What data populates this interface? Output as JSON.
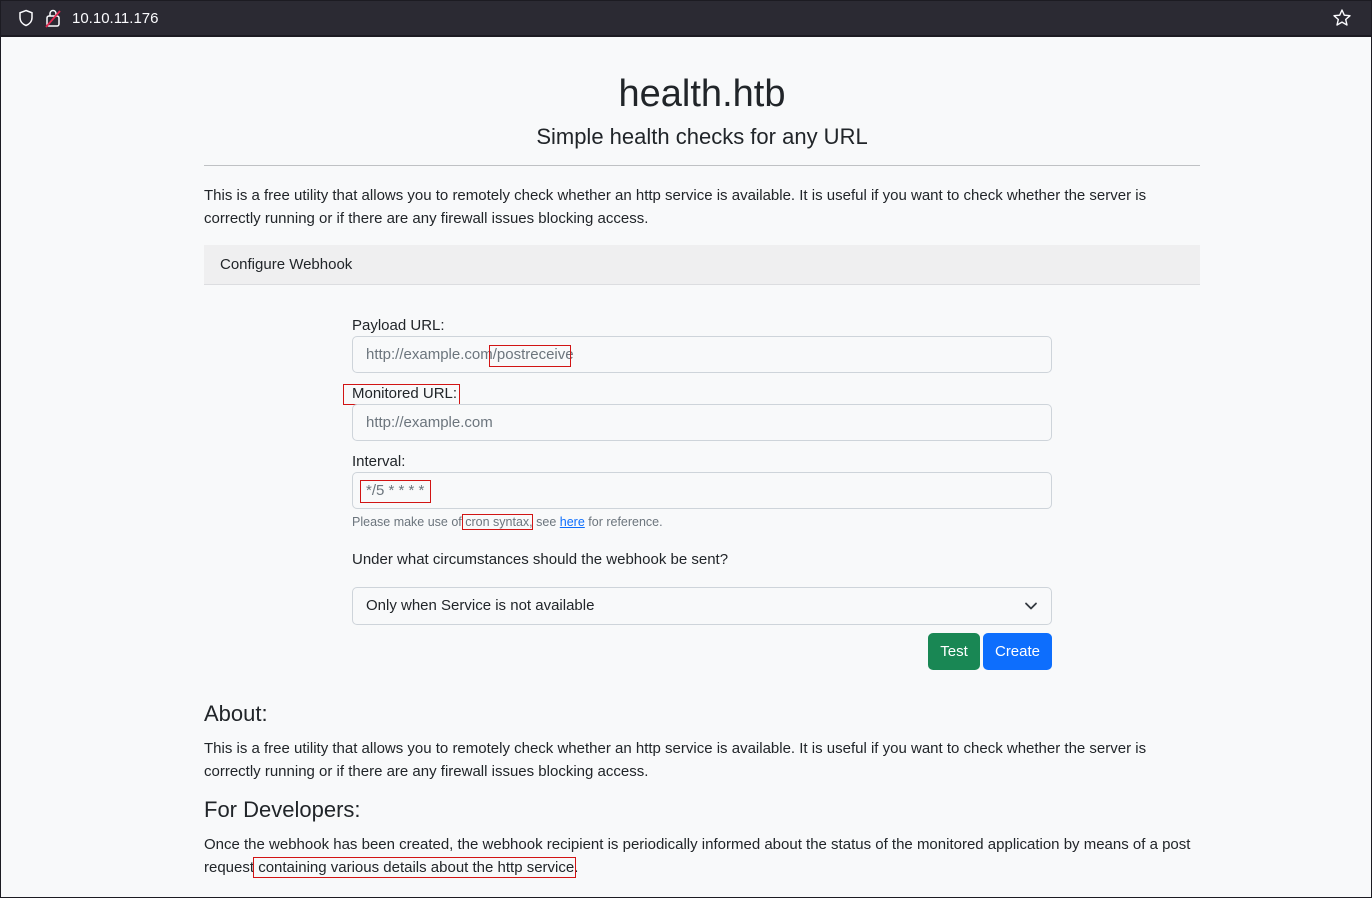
{
  "browser": {
    "url": "10.10.11.176"
  },
  "page": {
    "title": "health.htb",
    "subtitle": "Simple health checks for any URL",
    "intro": "This is a free utility that allows you to remotely check whether an http service is available. It is useful if you want to check whether the server is correctly running or if there are any firewall issues blocking access."
  },
  "webhook": {
    "header": "Configure Webhook",
    "payload_label": "Payload URL:",
    "payload_placeholder": "http://example.com/postreceive",
    "monitored_label": "Monitored URL:",
    "monitored_placeholder": "http://example.com",
    "interval_label": "Interval:",
    "interval_placeholder": "*/5 * * * *",
    "help_prefix": "Please make use of ",
    "help_cron": "cron syntax,",
    "help_mid": " see ",
    "help_link": "here",
    "help_suffix": " for reference.",
    "condition_label": "Under what circumstances should the webhook be sent?",
    "condition_selected": "Only when Service is not available",
    "test_button": "Test",
    "create_button": "Create"
  },
  "about": {
    "heading": "About:",
    "text": "This is a free utility that allows you to remotely check whether an http service is available. It is useful if you want to check whether the server is correctly running or if there are any firewall issues blocking access."
  },
  "developers": {
    "heading": "For Developers:",
    "text_line1": "Once the webhook has been created, the webhook recipient is periodically informed about the status of the monitored application by means of a post",
    "text_line2_prefix": "request ",
    "text_line2_highlight": "containing various details about the http service."
  },
  "colors": {
    "annotation_box": "#d11414",
    "test_button": "#198754",
    "create_button": "#0d6efd"
  }
}
